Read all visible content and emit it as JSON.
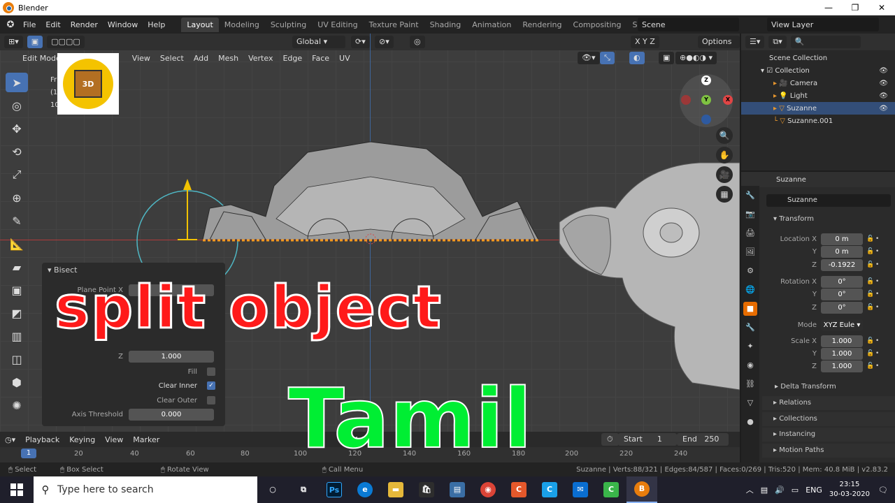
{
  "window": {
    "title": "Blender",
    "controls": [
      "—",
      "❐",
      "✕"
    ]
  },
  "menu": [
    "File",
    "Edit",
    "Render",
    "Window",
    "Help"
  ],
  "workspaces": [
    "Layout",
    "Modeling",
    "Sculpting",
    "UV Editing",
    "Texture Paint",
    "Shading",
    "Animation",
    "Rendering",
    "Compositing",
    "Scripting"
  ],
  "active_workspace": "Layout",
  "scene": "Scene",
  "view_layer": "View Layer",
  "viewport": {
    "mode": "Edit Mode",
    "menus": [
      "View",
      "Select",
      "Add",
      "Mesh",
      "Vertex",
      "Edge",
      "Face",
      "UV"
    ],
    "orientation": "Global",
    "options_label": "Options",
    "axes": [
      "X",
      "Y",
      "Z"
    ],
    "overlay_text_left": [
      "Fr",
      "(1",
      "10"
    ]
  },
  "bisect": {
    "title": "Bisect",
    "fields": [
      {
        "label": "Plane Point X",
        "value": ""
      },
      {
        "label": "Z",
        "value": "1.000"
      },
      {
        "label": "Fill",
        "value": false
      },
      {
        "label": "Clear Inner",
        "value": true
      },
      {
        "label": "Clear Outer",
        "value": false
      },
      {
        "label": "Axis Threshold",
        "value": "0.000"
      }
    ]
  },
  "overlay_title": {
    "line1": "split object",
    "line2": "Tamil"
  },
  "timeline": {
    "menus": [
      "Playback",
      "Keying",
      "View",
      "Marker"
    ],
    "current_frame": "1",
    "start_label": "Start",
    "start": "1",
    "end_label": "End",
    "end": "250",
    "ruler": [
      "20",
      "40",
      "60",
      "80",
      "100",
      "120",
      "140",
      "160",
      "180",
      "200",
      "220",
      "240"
    ]
  },
  "statusbar": {
    "items": [
      "Select",
      "Box Select",
      "Rotate View",
      "Call Menu"
    ],
    "stats": "Suzanne | Verts:88/321 | Edges:84/587 | Faces:0/269 | Tris:520 | Mem: 40.8 MiB | v2.83.2"
  },
  "outliner": {
    "root": "Scene Collection",
    "items": [
      {
        "name": "Collection",
        "level": 1,
        "selected": false
      },
      {
        "name": "Camera",
        "level": 2,
        "selected": false
      },
      {
        "name": "Light",
        "level": 2,
        "selected": false
      },
      {
        "name": "Suzanne",
        "level": 2,
        "selected": true
      },
      {
        "name": "Suzanne.001",
        "level": 2,
        "selected": false
      }
    ]
  },
  "properties": {
    "object": "Suzanne",
    "name": "Suzanne",
    "section": "Transform",
    "location": {
      "label": "Location X",
      "x": "0 m",
      "y": "0 m",
      "z": "-0.1922"
    },
    "rotation": {
      "label": "Rotation X",
      "x": "0°",
      "y": "0°",
      "z": "0°"
    },
    "mode_label": "Mode",
    "mode": "XYZ Eule",
    "scale": {
      "label": "Scale X",
      "x": "1.000",
      "y": "1.000",
      "z": "1.000"
    },
    "axis_labels": [
      "Y",
      "Z"
    ],
    "delta": "Delta Transform",
    "collapsed": [
      "Relations",
      "Collections",
      "Instancing",
      "Motion Paths"
    ]
  },
  "taskbar": {
    "search_placeholder": "Type here to search",
    "apps": [
      {
        "icon": "cortana-icon",
        "label": "○",
        "color": "transparent"
      },
      {
        "icon": "task-view-icon",
        "label": "⧉",
        "color": "transparent"
      },
      {
        "icon": "photoshop-icon",
        "label": "Ps",
        "color": "#001d34"
      },
      {
        "icon": "edge-icon",
        "label": "e",
        "color": "#0a7ad4"
      },
      {
        "icon": "file-explorer-icon",
        "label": "▬",
        "color": "#e5b83a"
      },
      {
        "icon": "store-icon",
        "label": "🛍",
        "color": "#2d2d2d"
      },
      {
        "icon": "powerpoint-icon",
        "label": "▤",
        "color": "#3a6ea5"
      },
      {
        "icon": "chrome-icon",
        "label": "◉",
        "color": "#db4437"
      },
      {
        "icon": "app-c-orange-icon",
        "label": "C",
        "color": "#e4582b"
      },
      {
        "icon": "app-c-blue-icon",
        "label": "C",
        "color": "#1aa0e8"
      },
      {
        "icon": "mail-icon",
        "label": "✉",
        "color": "#0a6ed1"
      },
      {
        "icon": "app-c-green-icon",
        "label": "C",
        "color": "#3ab54a"
      },
      {
        "icon": "blender-taskbar-icon",
        "label": "B",
        "color": "#e87d0d"
      }
    ],
    "lang": "ENG",
    "time": "23:15",
    "date": "30-03-2020"
  },
  "colors": {
    "accent": "#4772b3",
    "selection": "#334e78",
    "active_tab": "#e66c00",
    "overlay_red": "#ff1a1a",
    "overlay_green": "#00ee33"
  }
}
